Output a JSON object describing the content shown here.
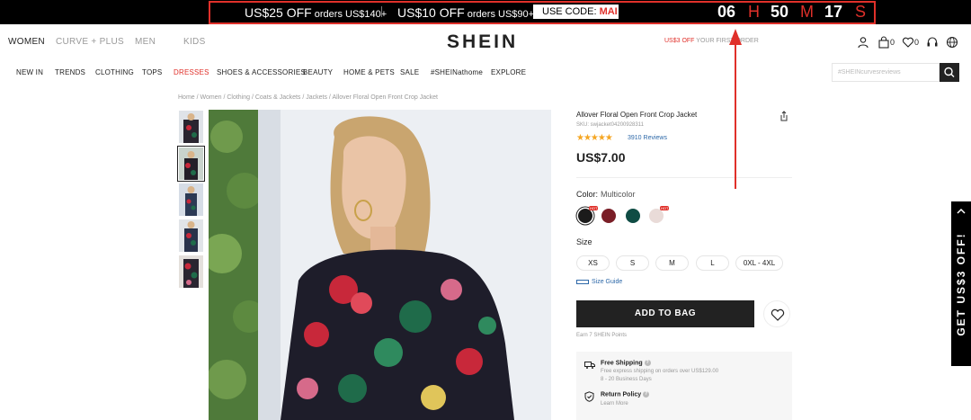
{
  "promo": {
    "offer1_amount": "US$25 OFF",
    "offer1_cond": " orders US$140+",
    "offer2_amount": "US$10 OFF",
    "offer2_cond": " orders US$90+",
    "code_label": "USE CODE: ",
    "code_value": "MAI",
    "countdown": {
      "hours": "06",
      "h": "H",
      "minutes": "50",
      "m": "M",
      "seconds": "17",
      "s": "S"
    }
  },
  "header": {
    "categories": [
      "WOMEN",
      "CURVE + PLUS",
      "MEN",
      "KIDS"
    ],
    "logo": "SHEIN",
    "first_order_red": "US$3 OFF",
    "first_order_rest": " YOUR FIRST ORDER",
    "bag_count": "0",
    "wish_count": "0"
  },
  "nav": {
    "items": [
      "NEW IN",
      "TRENDS",
      "CLOTHING",
      "TOPS",
      "DRESSES",
      "SHOES & ACCESSORIES",
      "BEAUTY",
      "HOME & PETS",
      "SALE",
      "#SHEINathome",
      "EXPLORE"
    ],
    "search_placeholder": "#SHEINcurvesreviews"
  },
  "breadcrumb": "Home / Women / Clothing / Coats & Jackets / Jackets / Allover Floral Open Front Crop Jacket",
  "product": {
    "title": "Allover Floral Open Front Crop Jacket",
    "sku": "SKU: swjacket04200928311",
    "rating": 4.5,
    "stars": "★★★★★",
    "reviews": "3910 Reviews",
    "price": "US$7.00",
    "color_label": "Color:",
    "color_value": "Multicolor",
    "colors": [
      {
        "hex": "#1b1b1b",
        "hot": "HOT"
      },
      {
        "hex": "#7a1e27",
        "hot": ""
      },
      {
        "hex": "#0f4c44",
        "hot": ""
      },
      {
        "hex": "#e9dbd8",
        "hot": "HOT"
      }
    ],
    "size_label": "Size",
    "sizes": [
      "XS",
      "S",
      "M",
      "L",
      "0XL - 4XL"
    ],
    "size_guide": "Size Guide",
    "add_to_bag": "ADD TO BAG",
    "earn": "Earn 7 SHEIN Points",
    "shipping_title": "Free Shipping",
    "shipping_desc": "Free express shipping on orders over US$129.00",
    "shipping_days": "8 - 20 Business Days",
    "return_title": "Return Policy",
    "return_desc": "Learn More"
  },
  "side_tab": "GET US$3 OFF!",
  "colors": {
    "accent_red": "#e0302a",
    "link_blue": "#2d68a8",
    "dark": "#222222"
  }
}
